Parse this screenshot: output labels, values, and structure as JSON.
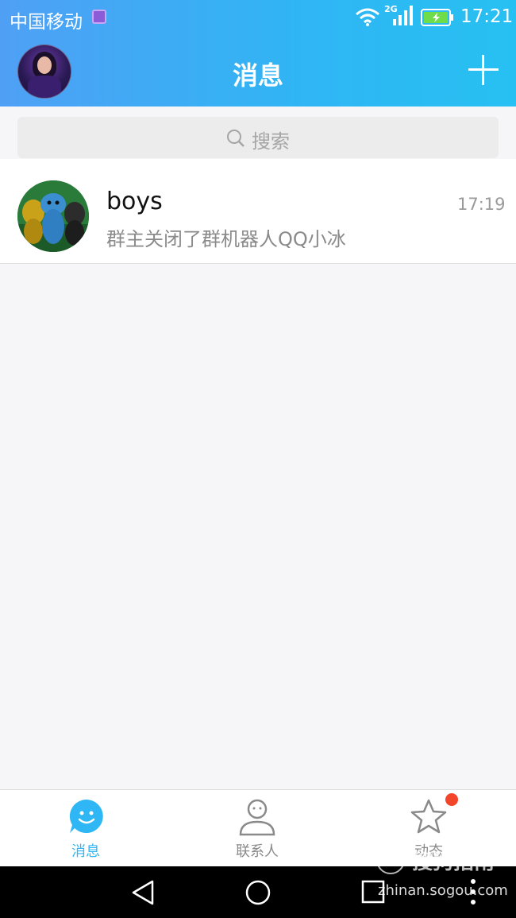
{
  "status_bar": {
    "carrier": "中国移动",
    "network": "2G",
    "time": "17:21"
  },
  "header": {
    "title": "消息"
  },
  "search": {
    "placeholder": "搜索"
  },
  "conversations": [
    {
      "name": "boys",
      "time": "17:19",
      "last_message": "群主关闭了群机器人QQ小冰"
    }
  ],
  "tabs": [
    {
      "label": "消息",
      "icon": "message-smile-icon",
      "active": true
    },
    {
      "label": "联系人",
      "icon": "contacts-person-icon",
      "active": false
    },
    {
      "label": "动态",
      "icon": "star-icon",
      "active": false,
      "badge": true
    }
  ],
  "watermark": {
    "title": "搜狗指南",
    "url": "zhinan.sogou.com"
  },
  "colors": {
    "accent": "#2fb6f4",
    "tab_active": "#2fb6f4",
    "tab_inactive": "#8a8a8a",
    "badge": "#f3452a"
  }
}
